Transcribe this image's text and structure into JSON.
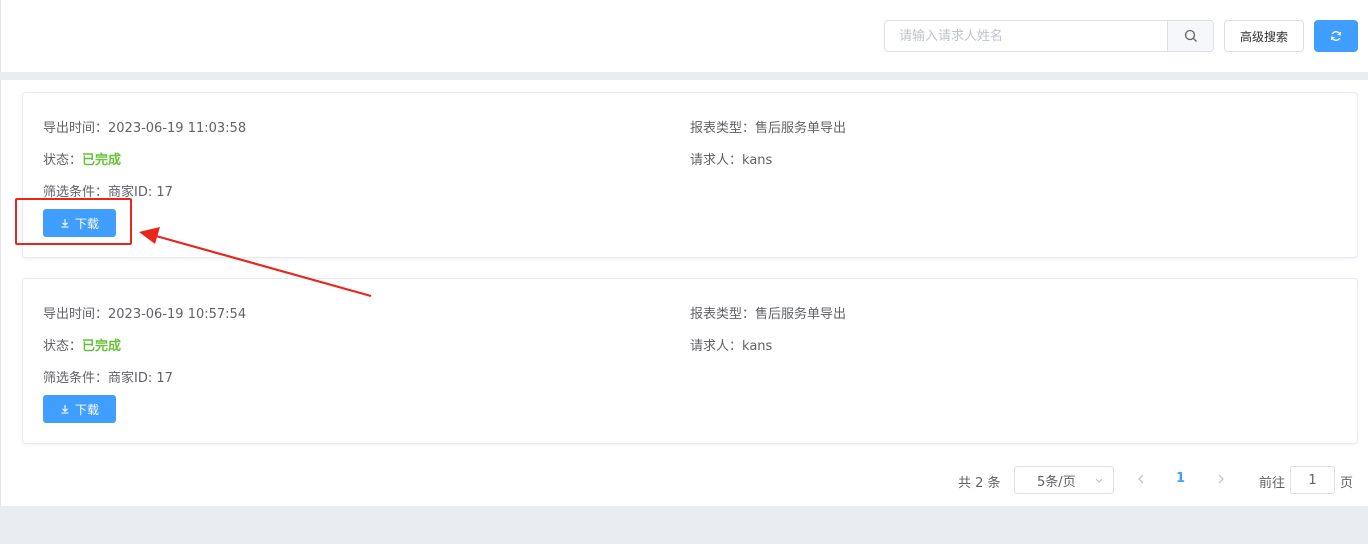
{
  "toolbar": {
    "search_placeholder": "请输入请求人姓名",
    "search_icon": "search-icon",
    "advanced_search_label": "高级搜索",
    "refresh_icon": "refresh-icon"
  },
  "records": [
    {
      "export_time_label": "导出时间：",
      "export_time": "2023-06-19 11:03:58",
      "report_type_label": "报表类型：",
      "report_type": "售后服务单导出",
      "status_label": "状态：",
      "status": "已完成",
      "requester_label": "请求人：",
      "requester": "kans",
      "filter_label": "筛选条件：",
      "filter": "商家ID: 17",
      "download_label": "下载"
    },
    {
      "export_time_label": "导出时间：",
      "export_time": "2023-06-19 10:57:54",
      "report_type_label": "报表类型：",
      "report_type": "售后服务单导出",
      "status_label": "状态：",
      "status": "已完成",
      "requester_label": "请求人：",
      "requester": "kans",
      "filter_label": "筛选条件：",
      "filter": "商家ID: 17",
      "download_label": "下载"
    }
  ],
  "pagination": {
    "total_text": "共 2 条",
    "page_size": "5条/页",
    "current_page": "1",
    "goto_prefix": "前往",
    "goto_value": "1",
    "goto_suffix": "页"
  },
  "colors": {
    "primary": "#409eff",
    "success": "#67c23a",
    "annotation": "#e8261c"
  }
}
